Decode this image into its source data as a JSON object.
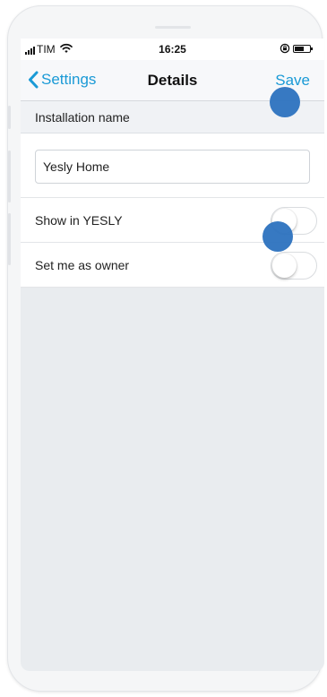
{
  "status_bar": {
    "carrier": "TIM",
    "time": "16:25"
  },
  "nav": {
    "back_label": "Settings",
    "title": "Details",
    "save_label": "Save"
  },
  "section": {
    "header": "Installation name"
  },
  "installation_name_field": {
    "value": "Yesly Home"
  },
  "rows": [
    {
      "label": "Show in YESLY",
      "toggle_on": false
    },
    {
      "label": "Set me as owner",
      "toggle_on": false
    }
  ],
  "colors": {
    "accent": "#1a9ad6",
    "touch_marker": "#2f74bf",
    "screen_background": "#e9ecef"
  },
  "icons": {
    "signal": "signal-bars-icon",
    "wifi": "wifi-icon",
    "rotation_lock": "rotation-lock-icon",
    "battery": "battery-icon",
    "back": "chevron-left-icon"
  }
}
